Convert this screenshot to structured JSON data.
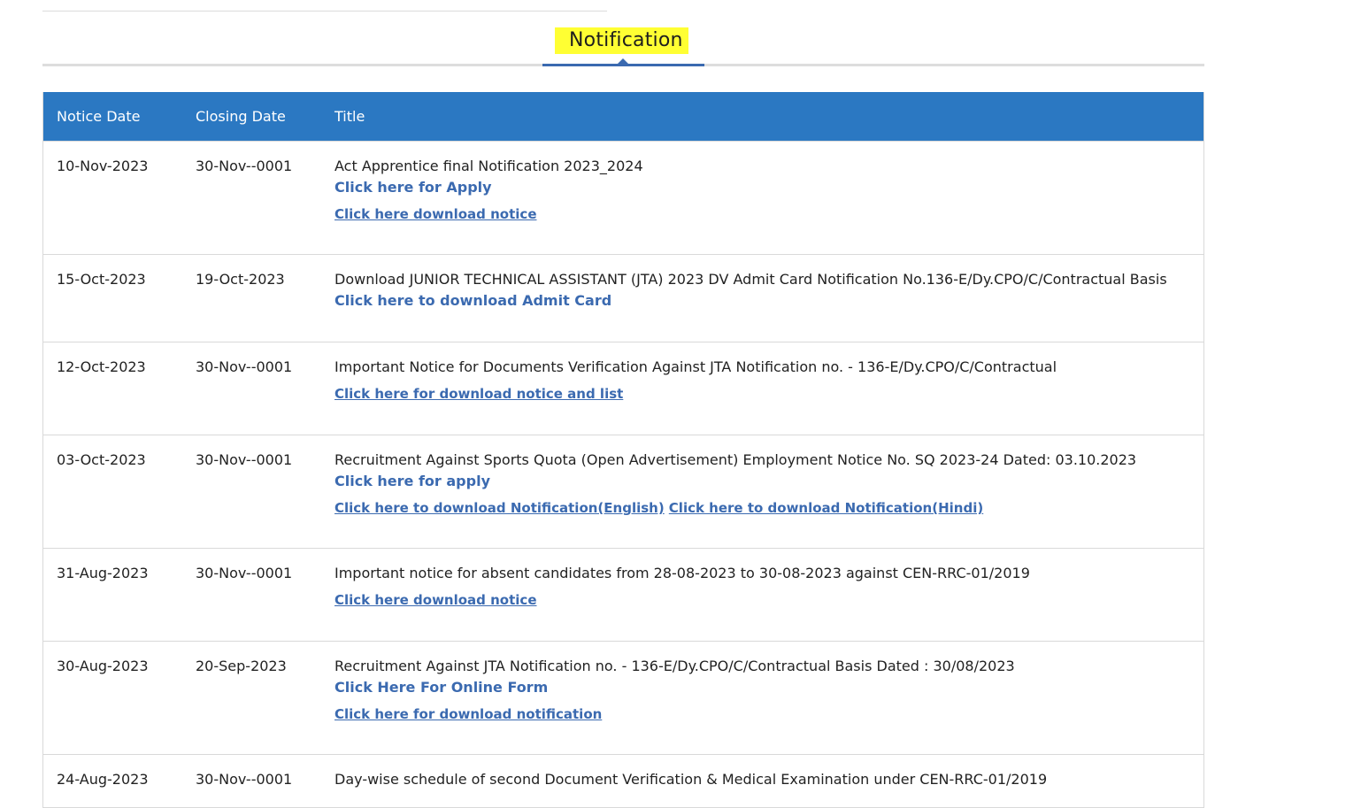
{
  "tab": {
    "label": "Notification"
  },
  "table": {
    "headers": [
      "Notice Date",
      "Closing Date",
      "Title"
    ],
    "rows": [
      {
        "notice_date": "10-Nov-2023",
        "closing_date": "30-Nov--0001",
        "title": "Act Apprentice final Notification 2023_2024",
        "apply_link": "Click here for Apply",
        "download_links": [
          "Click here download notice"
        ]
      },
      {
        "notice_date": "15-Oct-2023",
        "closing_date": "19-Oct-2023",
        "title": "Download JUNIOR TECHNICAL ASSISTANT (JTA) 2023 DV Admit Card Notification No.136-E/Dy.CPO/C/Contractual Basis",
        "apply_link": "Click here to download Admit Card",
        "download_links": []
      },
      {
        "notice_date": "12-Oct-2023",
        "closing_date": "30-Nov--0001",
        "title": "Important Notice for Documents Verification Against JTA Notification no. - 136-E/Dy.CPO/C/Contractual",
        "apply_link": "",
        "download_links": [
          "Click here for download notice and list"
        ]
      },
      {
        "notice_date": "03-Oct-2023",
        "closing_date": "30-Nov--0001",
        "title": "Recruitment Against Sports Quota (Open Advertisement) Employment Notice No. SQ 2023-24 Dated: 03.10.2023",
        "apply_link": "Click here for apply",
        "download_links": [
          "Click here to download Notification(English)",
          "Click here to download Notification(Hindi)"
        ]
      },
      {
        "notice_date": "31-Aug-2023",
        "closing_date": "30-Nov--0001",
        "title": "Important notice for absent candidates from 28-08-2023 to 30-08-2023 against CEN-RRC-01/2019",
        "apply_link": "",
        "download_links": [
          "Click here download notice"
        ]
      },
      {
        "notice_date": "30-Aug-2023",
        "closing_date": "20-Sep-2023",
        "title": "Recruitment Against JTA Notification no. - 136-E/Dy.CPO/C/Contractual Basis Dated : 30/08/2023",
        "apply_link": "Click Here For Online Form",
        "download_links": [
          "Click here for download notification"
        ]
      },
      {
        "notice_date": "24-Aug-2023",
        "closing_date": "30-Nov--0001",
        "title": "Day-wise schedule of second Document Verification & Medical Examination under CEN-RRC-01/2019",
        "apply_link": "",
        "download_links": []
      }
    ]
  }
}
